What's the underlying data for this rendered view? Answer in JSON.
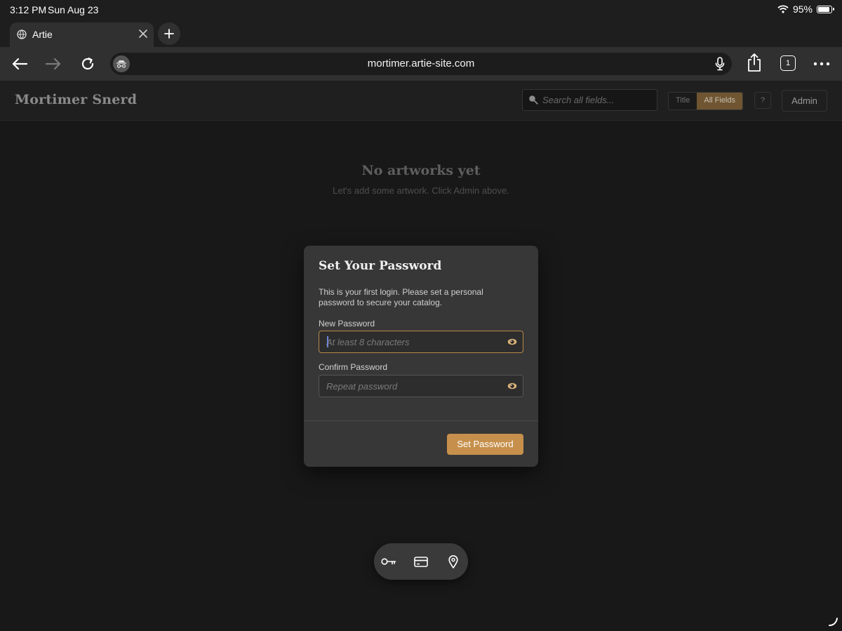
{
  "status_bar": {
    "time": "3:12 PM",
    "date": "Sun Aug 23",
    "battery": "95%",
    "battery_level": 0.95,
    "icons": [
      "wifi-icon",
      "battery-icon"
    ]
  },
  "browser": {
    "tab_title": "Artie",
    "tab_count": "1",
    "url": "mortimer.artie-site.com",
    "icons": [
      "globe-icon",
      "close-icon",
      "plus-icon",
      "back-arrow-icon",
      "forward-arrow-icon",
      "reload-icon",
      "privacy-icon",
      "microphone-icon",
      "share-icon",
      "more-icon"
    ]
  },
  "site": {
    "title": "Mortimer Snerd",
    "search_placeholder": "Search all fields...",
    "search_modes": [
      "Title",
      "All Fields"
    ],
    "active_search_mode": "All Fields",
    "help_label": "?",
    "admin_label": "Admin",
    "accent_color": "#c6904c"
  },
  "empty_state": {
    "title": "No artworks yet",
    "subtitle": "Let's add some artwork. Click Admin above."
  },
  "modal": {
    "title": "Set Your Password",
    "description": "This is your first login. Please set a personal password to secure your catalog.",
    "new_password_label": "New Password",
    "new_password_placeholder": "At least 8 characters",
    "new_password_value": "",
    "confirm_password_label": "Confirm Password",
    "confirm_password_placeholder": "Repeat password",
    "confirm_password_value": "",
    "submit_label": "Set Password"
  },
  "autofill": {
    "icons": [
      "key-icon",
      "credit-card-icon",
      "location-pin-icon"
    ]
  }
}
